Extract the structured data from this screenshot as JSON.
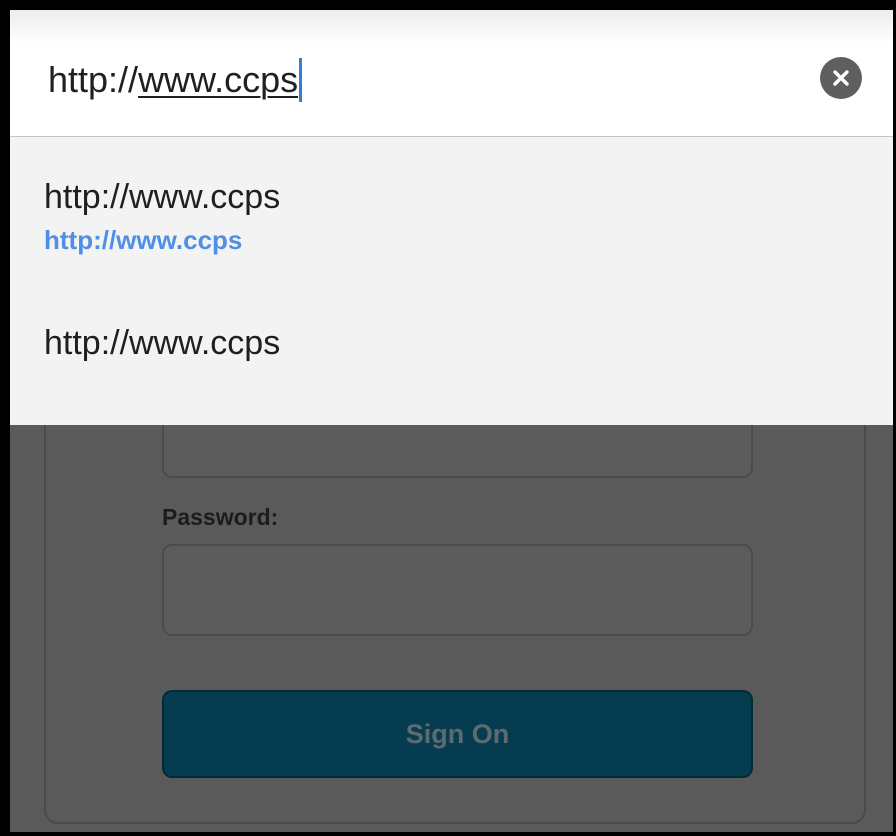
{
  "url_bar": {
    "value_prefix": "http://",
    "value_underlined": "www.ccps",
    "clear_icon": "close-circle-icon"
  },
  "suggestions": [
    {
      "title": "http://www.ccps",
      "url": "http://www.ccps"
    },
    {
      "title": "http://www.ccps"
    }
  ],
  "page": {
    "password_label": "Password:",
    "signon_label": "Sign On"
  },
  "colors": {
    "accent_blue": "#4f8fe6",
    "signon_button": "#053c4f",
    "dim_overlay": "#5a5a5a"
  }
}
